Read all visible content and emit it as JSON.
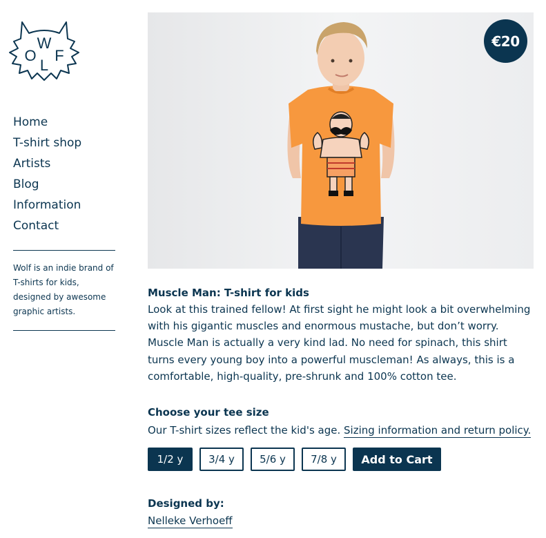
{
  "brand": {
    "logo_letters": [
      "W",
      "O",
      "L",
      "F"
    ],
    "logo_icon": "wolf-head-icon",
    "accent_color": "#0b3550"
  },
  "nav": {
    "items": [
      {
        "label": "Home"
      },
      {
        "label": "T-shirt shop"
      },
      {
        "label": "Artists"
      },
      {
        "label": "Blog"
      },
      {
        "label": "Information"
      },
      {
        "label": "Contact"
      }
    ]
  },
  "about": {
    "text": "Wolf is an indie brand of T-shirts for kids, designed by awesome graphic artists."
  },
  "product": {
    "price": "€20",
    "title": "Muscle Man: T-shirt for kids",
    "description": "Look at this trained fellow! At first sight he might look a bit overwhelming with his gigantic muscles and enormous mustache, but don’t worry. Muscle Man is actually a very kind lad. No need for spinach, this shirt turns every young boy into a powerful muscleman! As always, this is a comfortable, high-quality, pre-shrunk and 100% cotton tee.",
    "image_icon": "product-photo-boy-in-orange-tshirt"
  },
  "size": {
    "heading": "Choose your tee size",
    "text": "Our T-shirt sizes reflect the kid's age.",
    "link": "Sizing information and return policy.",
    "options": [
      {
        "label": "1/2 y",
        "selected": true
      },
      {
        "label": "3/4 y",
        "selected": false
      },
      {
        "label": "5/6 y",
        "selected": false
      },
      {
        "label": "7/8 y",
        "selected": false
      }
    ],
    "selected": "1/2 y",
    "cart_label": "Add to Cart"
  },
  "designer": {
    "heading": "Designed by:",
    "name": "Nelleke Verhoeff"
  }
}
